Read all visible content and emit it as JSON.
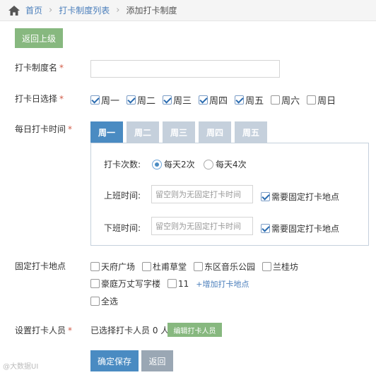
{
  "breadcrumb": {
    "home": "首页",
    "list": "打卡制度列表",
    "current": "添加打卡制度"
  },
  "actions": {
    "back_top": "返回上级",
    "save": "确定保存",
    "back": "返回",
    "edit_people": "编辑打卡人员"
  },
  "form": {
    "name_label": "打卡制度名",
    "name_value": "",
    "days_label": "打卡日选择",
    "days": [
      {
        "label": "周一",
        "checked": true
      },
      {
        "label": "周二",
        "checked": true
      },
      {
        "label": "周三",
        "checked": true
      },
      {
        "label": "周四",
        "checked": true
      },
      {
        "label": "周五",
        "checked": true
      },
      {
        "label": "周六",
        "checked": false
      },
      {
        "label": "周日",
        "checked": false
      }
    ],
    "daily_label": "每日打卡时间",
    "tabs": [
      "周一",
      "周二",
      "周三",
      "周四",
      "周五"
    ],
    "active_tab": 0,
    "panel": {
      "count_label": "打卡次数:",
      "count_options": [
        "每天2次",
        "每天4次"
      ],
      "count_selected": 0,
      "on_label": "上班时间:",
      "off_label": "下班时间:",
      "time_placeholder": "留空则为无固定打卡时间",
      "fixed_location_label": "需要固定打卡地点",
      "on_fixed": true,
      "off_fixed": true
    },
    "location_label": "固定打卡地点",
    "locations": [
      {
        "label": "天府广场",
        "checked": false
      },
      {
        "label": "杜甫草堂",
        "checked": false
      },
      {
        "label": "东区音乐公园",
        "checked": false
      },
      {
        "label": "兰桂坊",
        "checked": false
      },
      {
        "label": "豪庭万丈写字楼",
        "checked": false
      },
      {
        "label": "11",
        "checked": false
      }
    ],
    "add_location": "+增加打卡地点",
    "select_all": "全选",
    "people_label": "设置打卡人员",
    "people_selected": "已选择打卡人员 0 人",
    "required_mark": "*"
  },
  "watermark": "@大数据UI",
  "colors": {
    "primary": "#4a8bc2",
    "success": "#87b87f",
    "required": "#d15b47",
    "link": "#4a7ebb"
  }
}
